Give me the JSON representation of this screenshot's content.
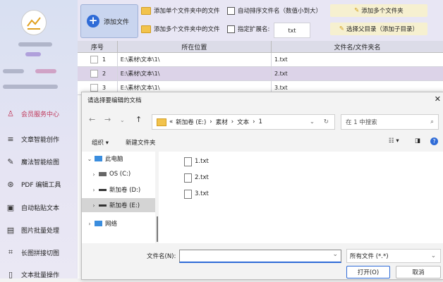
{
  "sidebar": {
    "items": [
      {
        "label": "会员服务中心",
        "icon": "user-icon",
        "active": true
      },
      {
        "label": "文章智能创作",
        "icon": "list-icon"
      },
      {
        "label": "魔法智能绘图",
        "icon": "brush-icon"
      },
      {
        "label": "PDF 编辑工具",
        "icon": "pdf-icon"
      },
      {
        "label": "自动粘贴文本",
        "icon": "paste-icon"
      },
      {
        "label": "图片批量处理",
        "icon": "image-icon"
      },
      {
        "label": "长图拼接切图",
        "icon": "crop-icon"
      },
      {
        "label": "文本批量操作",
        "icon": "text-icon"
      }
    ]
  },
  "toolbar": {
    "add_file": "添加文件",
    "add_single_folder": "添加单个文件夹中的文件",
    "add_multi_folder": "添加多个文件夹中的文件",
    "auto_sort": "自动排序文件名（数值小到大）",
    "specify_ext": "指定扩展名:",
    "ext_value": "txt",
    "add_multi_folders": "添加多个文件夹",
    "select_parent": "选择父目录（添加子目录）"
  },
  "table": {
    "headers": [
      "序号",
      "所在位置",
      "文件名/文件夹名"
    ],
    "rows": [
      {
        "index": "1",
        "path": "E:\\素材\\文本\\1\\",
        "name": "1.txt"
      },
      {
        "index": "2",
        "path": "E:\\素材\\文本\\1\\",
        "name": "2.txt"
      },
      {
        "index": "3",
        "path": "E:\\素材\\文本\\1\\",
        "name": "3.txt"
      }
    ]
  },
  "dialog": {
    "title": "请选择要编辑的文档",
    "address": [
      "«",
      "新加卷 (E:)",
      "›",
      "素材",
      "›",
      "文本",
      "›",
      "1"
    ],
    "search_placeholder": "在 1 中搜索",
    "organize": "组织 ▾",
    "new_folder": "新建文件夹",
    "tree": [
      {
        "label": "此电脑",
        "chev": "⌄"
      },
      {
        "label": "OS (C:)",
        "chev": "›"
      },
      {
        "label": "新加卷 (D:)",
        "chev": "›"
      },
      {
        "label": "新加卷 (E:)",
        "chev": "›",
        "selected": true
      },
      {
        "label": "网络",
        "chev": "›"
      }
    ],
    "files": [
      "1.txt",
      "2.txt",
      "3.txt"
    ],
    "filename_label": "文件名(N):",
    "filename_value": "",
    "filetype": "所有文件 (*.*)",
    "open": "打开(O)",
    "cancel": "取消"
  }
}
